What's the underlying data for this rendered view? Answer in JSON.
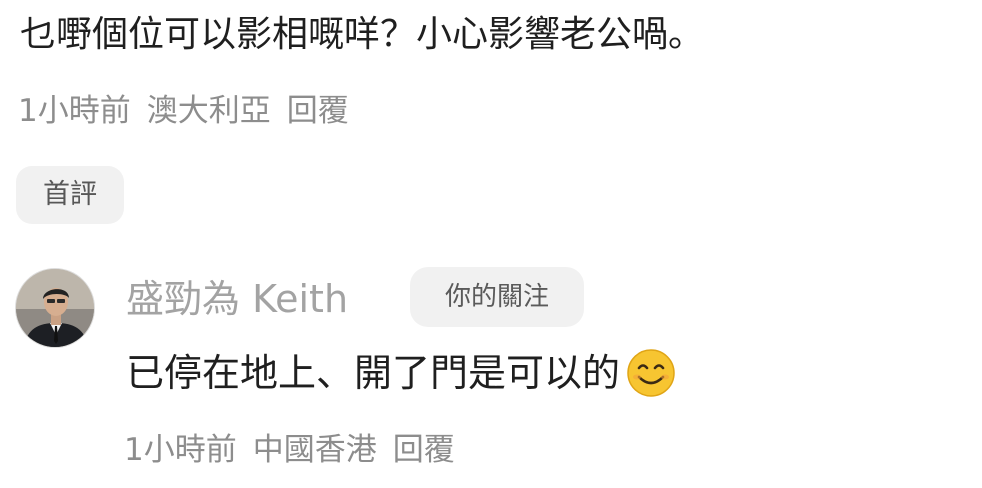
{
  "comment1": {
    "text": "乜嘢個位可以影相嘅咩？小心影響老公喎。",
    "time": "1小時前",
    "location": "澳大利亞",
    "reply_label": "回覆"
  },
  "first_comment_tag": "首評",
  "comment2": {
    "author": "盛勁為 Keith",
    "follow_badge": "你的關注",
    "text": "已停在地上、開了門是可以的",
    "emoji": "smiling-face-emoji",
    "time": "1小時前",
    "location": "中國香港",
    "reply_label": "回覆"
  },
  "colors": {
    "primary_text": "#1f1f1f",
    "meta_text": "#8d8d8d",
    "author_text": "#a3a3a3",
    "tag_bg": "#f1f1f1"
  }
}
